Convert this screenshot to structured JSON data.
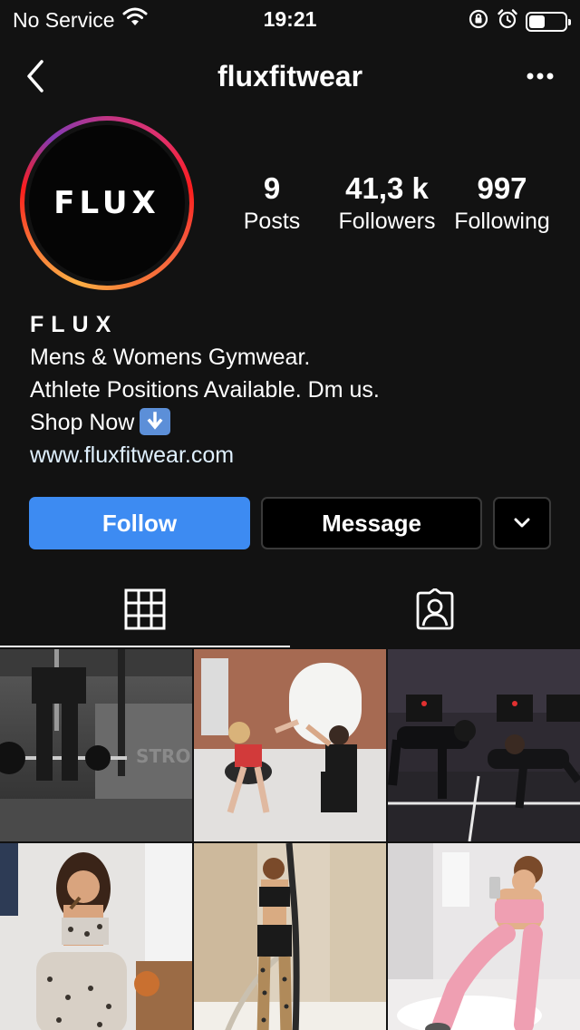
{
  "status_bar": {
    "carrier": "No Service",
    "time": "19:21",
    "icons": [
      "wifi-icon",
      "orientation-lock-icon",
      "alarm-icon",
      "battery-icon"
    ],
    "battery_level": 0.45
  },
  "header": {
    "username": "fluxfitwear",
    "back_icon": "chevron-left-icon",
    "more_icon": "more-horizontal-icon"
  },
  "profile": {
    "avatar_text": "FLUX",
    "stats": [
      {
        "value": "9",
        "label": "Posts"
      },
      {
        "value": "41,3 k",
        "label": "Followers"
      },
      {
        "value": "997",
        "label": "Following"
      }
    ],
    "bio": {
      "name": "FLUX",
      "line1": "Mens & Womens Gymwear.",
      "line2": "Athlete Positions Available. Dm us.",
      "line3": "Shop Now",
      "link": "www.fluxfitwear.com"
    }
  },
  "actions": {
    "follow_label": "Follow",
    "message_label": "Message",
    "more_icon": "chevron-down-icon"
  },
  "tabs": [
    {
      "icon": "grid-icon",
      "active": true
    },
    {
      "icon": "tagged-user-icon",
      "active": false
    }
  ],
  "colors": {
    "background": "#121212",
    "follow_button": "#3d8bf2",
    "link": "#e0f1ff"
  },
  "posts": [
    {
      "icon": "gym-photo-barbell"
    },
    {
      "icon": "gym-photo-high-five"
    },
    {
      "icon": "gym-photo-plank"
    },
    {
      "icon": "photo-woman-leopard-set"
    },
    {
      "icon": "photo-woman-battle-rope"
    },
    {
      "icon": "photo-woman-pink-set"
    }
  ]
}
